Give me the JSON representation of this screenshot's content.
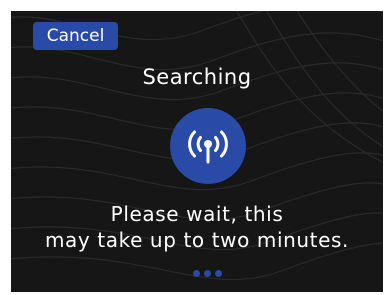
{
  "header": {
    "cancel_label": "Cancel"
  },
  "status": {
    "title": "Searching"
  },
  "message": {
    "line1": "Please wait, this",
    "line2": "may take up to two minutes."
  },
  "progress": {
    "dot_count": 3
  },
  "icons": {
    "center": "signal-tower-icon"
  },
  "colors": {
    "accent": "#2a4aa8",
    "background": "#161616",
    "text": "#ffffff"
  }
}
